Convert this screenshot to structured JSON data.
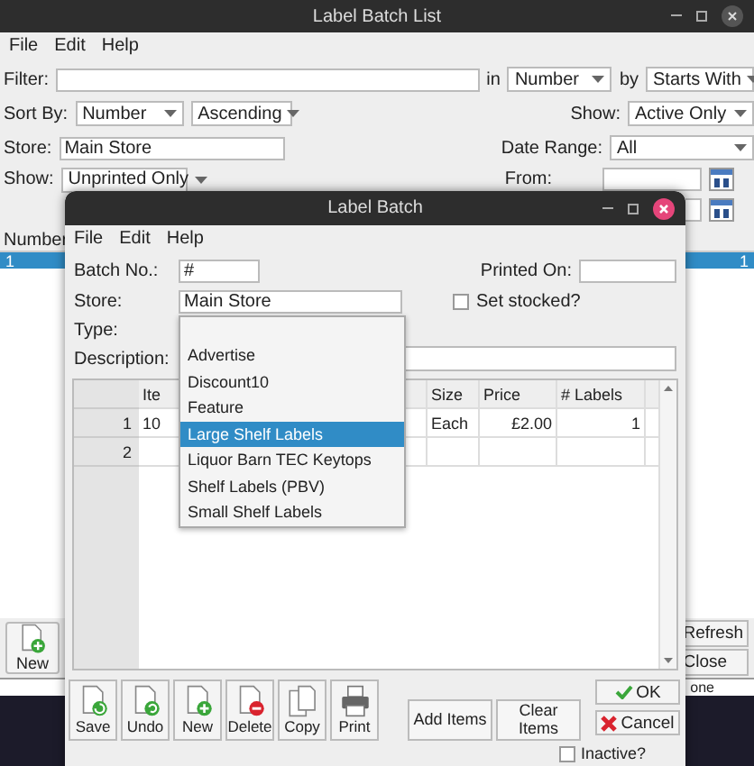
{
  "main_window": {
    "title": "Label Batch List",
    "menu": [
      "File",
      "Edit",
      "Help"
    ],
    "filter": {
      "label": "Filter:",
      "in_label": "in",
      "in_value": "Number",
      "by_label": "by",
      "by_value": "Starts With"
    },
    "sort": {
      "label": "Sort By:",
      "field": "Number",
      "order": "Ascending",
      "show_label": "Show:",
      "show_value": "Active Only"
    },
    "store": {
      "label": "Store:",
      "value": "Main Store",
      "date_label": "Date Range:",
      "date_value": "All"
    },
    "show": {
      "label": "Show:",
      "value": "Unprinted Only",
      "from_label": "From:"
    },
    "table": {
      "columns": [
        "Number"
      ],
      "rows": [
        {
          "selected": true,
          "cells": [
            "1",
            "1"
          ]
        }
      ]
    },
    "new_button": "New",
    "refresh_button": "Refresh",
    "close_button": "Close",
    "status_bar": "one"
  },
  "dialog": {
    "title": "Label Batch",
    "menu": [
      "File",
      "Edit",
      "Help"
    ],
    "batch_no": {
      "label": "Batch No.:",
      "value": "#"
    },
    "printed_on": {
      "label": "Printed On:"
    },
    "store": {
      "label": "Store:",
      "value": "Main Store"
    },
    "set_stocked": {
      "label": "Set stocked?",
      "checked": false
    },
    "type": {
      "label": "Type:",
      "options": [
        {
          "label": "Advertise",
          "selected": false
        },
        {
          "label": "Discount10",
          "selected": false
        },
        {
          "label": "Feature",
          "selected": false
        },
        {
          "label": "Large Shelf Labels",
          "selected": true
        },
        {
          "label": "Liquor Barn TEC Keytops",
          "selected": false
        },
        {
          "label": "Shelf Labels (PBV)",
          "selected": false
        },
        {
          "label": "Small Shelf Labels",
          "selected": false
        }
      ]
    },
    "description": {
      "label": "Description:"
    },
    "grid": {
      "columns": [
        "Ite",
        "Size",
        "Price",
        "# Labels"
      ],
      "rows": [
        {
          "number": "1",
          "cells": [
            "10",
            "Each",
            "£2.00",
            "1"
          ]
        },
        {
          "number": "2",
          "cells": []
        }
      ]
    },
    "toolbar": [
      {
        "kind": "save",
        "label": "Save"
      },
      {
        "kind": "undo",
        "label": "Undo"
      },
      {
        "kind": "new",
        "label": "New"
      },
      {
        "kind": "delete",
        "label": "Delete"
      },
      {
        "kind": "copy",
        "label": "Copy"
      },
      {
        "kind": "print",
        "label": "Print"
      }
    ],
    "add_items": "Add Items",
    "clear_items": "Clear Items",
    "ok": "OK",
    "cancel": "Cancel",
    "inactive": {
      "label": "Inactive?",
      "checked": false
    }
  }
}
